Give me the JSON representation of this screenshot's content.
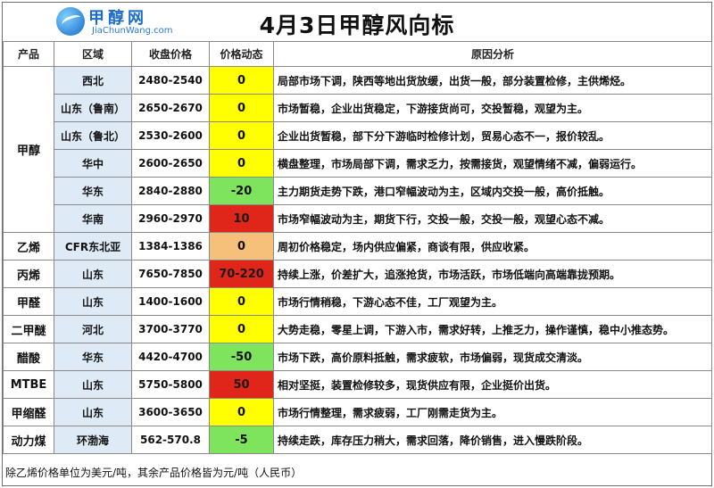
{
  "header": {
    "logo_cn": "甲醇网",
    "logo_en": "JiaChunWang.com",
    "title": "4月3日甲醇风向标"
  },
  "columns": [
    "产品",
    "区域",
    "收盘价格",
    "价格动态",
    "原因分析"
  ],
  "colors": {
    "yellow": "#ffff00",
    "green": "#7ee35d",
    "red": "#e0261b",
    "orange": "#f7c07a"
  },
  "rows": [
    {
      "product": "甲醇",
      "region": "西北",
      "price": "2480-2540",
      "change": "0",
      "color": "yellow",
      "analysis": "局部市场下调，陕西等地出货放缓，出货一般，部分装置检修，主供烯烃。"
    },
    {
      "product": "",
      "region": "山东（鲁南）",
      "price": "2650-2670",
      "change": "0",
      "color": "yellow",
      "analysis": "市场暂稳，企业出货稳定，下游接货尚可，交投暂稳，观望为主。"
    },
    {
      "product": "",
      "region": "山东（鲁北）",
      "price": "2530-2600",
      "change": "0",
      "color": "yellow",
      "analysis": "企业出货暂稳，部下分下游临时检修计划，贸易心态不一，报价较乱。"
    },
    {
      "product": "",
      "region": "华中",
      "price": "2600-2650",
      "change": "0",
      "color": "yellow",
      "analysis": "横盘整理，市场局部下调，需求乏力，按需接货，观望情绪不减，偏弱运行。"
    },
    {
      "product": "",
      "region": "华东",
      "price": "2840-2880",
      "change": "-20",
      "color": "green",
      "analysis": "主力期货走势下跌，港口窄幅波动为主，区域内交投一般，高价抵触。"
    },
    {
      "product": "",
      "region": "华南",
      "price": "2960-2970",
      "change": "10",
      "color": "red",
      "analysis": "市场窄幅波动为主，期货下行，交投一般，交投一般，观望心态不减。"
    },
    {
      "product": "乙烯",
      "region": "CFR东北亚",
      "price": "1384-1386",
      "change": "0",
      "color": "orange",
      "analysis": "周初价格稳定，场内供应偏紧，商谈有限，供应收紧。"
    },
    {
      "product": "丙烯",
      "region": "山东",
      "price": "7650-7850",
      "change": "70-220",
      "color": "red",
      "analysis": "持续上涨，价差扩大，追涨抢货，市场活跃，市场低端向高端靠拢预期。"
    },
    {
      "product": "甲醛",
      "region": "山东",
      "price": "1400-1600",
      "change": "0",
      "color": "yellow",
      "analysis": "市场行情稍稳，下游心态不佳，工厂观望为主。"
    },
    {
      "product": "二甲醚",
      "region": "河北",
      "price": "3700-3770",
      "change": "0",
      "color": "yellow",
      "analysis": "大势走稳，零星上调，下游入市，需求好转，上推乏力，操作谨慎，稳中小推态势。"
    },
    {
      "product": "醋酸",
      "region": "华东",
      "price": "4420-4700",
      "change": "-50",
      "color": "green",
      "analysis": "市场下跌，高价原料抵触，需求疲软，市场偏弱，现货成交清淡。"
    },
    {
      "product": "MTBE",
      "region": "山东",
      "price": "5750-5800",
      "change": "50",
      "color": "red",
      "analysis": "相对坚挺，装置检修较多，现货供应有限，企业挺价出货。"
    },
    {
      "product": "甲缩醛",
      "region": "山东",
      "price": "3600-3650",
      "change": "0",
      "color": "yellow",
      "analysis": "市场行情整理，需求疲弱，工厂刚需走货为主。"
    },
    {
      "product": "动力煤",
      "region": "环渤海",
      "price": "562-570.8",
      "change": "-5",
      "color": "green",
      "analysis": "持续走跌，库存压力稍大，需求回落，降价销售，进入慢跌阶段。"
    }
  ],
  "footer": "除乙烯价格单位为美元/吨，其余产品价格皆为元/吨（人民币）"
}
